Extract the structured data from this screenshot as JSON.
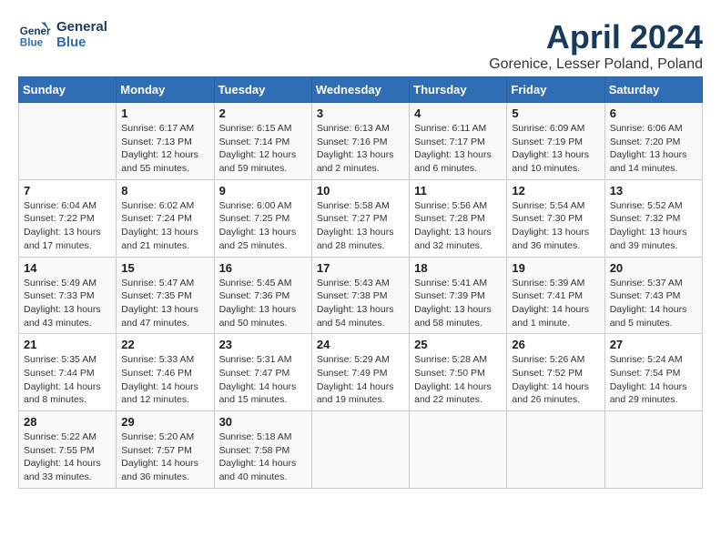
{
  "header": {
    "logo_line1": "General",
    "logo_line2": "Blue",
    "title": "April 2024",
    "location": "Gorenice, Lesser Poland, Poland"
  },
  "days_of_week": [
    "Sunday",
    "Monday",
    "Tuesday",
    "Wednesday",
    "Thursday",
    "Friday",
    "Saturday"
  ],
  "weeks": [
    [
      {
        "day": "",
        "info": ""
      },
      {
        "day": "1",
        "info": "Sunrise: 6:17 AM\nSunset: 7:13 PM\nDaylight: 12 hours\nand 55 minutes."
      },
      {
        "day": "2",
        "info": "Sunrise: 6:15 AM\nSunset: 7:14 PM\nDaylight: 12 hours\nand 59 minutes."
      },
      {
        "day": "3",
        "info": "Sunrise: 6:13 AM\nSunset: 7:16 PM\nDaylight: 13 hours\nand 2 minutes."
      },
      {
        "day": "4",
        "info": "Sunrise: 6:11 AM\nSunset: 7:17 PM\nDaylight: 13 hours\nand 6 minutes."
      },
      {
        "day": "5",
        "info": "Sunrise: 6:09 AM\nSunset: 7:19 PM\nDaylight: 13 hours\nand 10 minutes."
      },
      {
        "day": "6",
        "info": "Sunrise: 6:06 AM\nSunset: 7:20 PM\nDaylight: 13 hours\nand 14 minutes."
      }
    ],
    [
      {
        "day": "7",
        "info": "Sunrise: 6:04 AM\nSunset: 7:22 PM\nDaylight: 13 hours\nand 17 minutes."
      },
      {
        "day": "8",
        "info": "Sunrise: 6:02 AM\nSunset: 7:24 PM\nDaylight: 13 hours\nand 21 minutes."
      },
      {
        "day": "9",
        "info": "Sunrise: 6:00 AM\nSunset: 7:25 PM\nDaylight: 13 hours\nand 25 minutes."
      },
      {
        "day": "10",
        "info": "Sunrise: 5:58 AM\nSunset: 7:27 PM\nDaylight: 13 hours\nand 28 minutes."
      },
      {
        "day": "11",
        "info": "Sunrise: 5:56 AM\nSunset: 7:28 PM\nDaylight: 13 hours\nand 32 minutes."
      },
      {
        "day": "12",
        "info": "Sunrise: 5:54 AM\nSunset: 7:30 PM\nDaylight: 13 hours\nand 36 minutes."
      },
      {
        "day": "13",
        "info": "Sunrise: 5:52 AM\nSunset: 7:32 PM\nDaylight: 13 hours\nand 39 minutes."
      }
    ],
    [
      {
        "day": "14",
        "info": "Sunrise: 5:49 AM\nSunset: 7:33 PM\nDaylight: 13 hours\nand 43 minutes."
      },
      {
        "day": "15",
        "info": "Sunrise: 5:47 AM\nSunset: 7:35 PM\nDaylight: 13 hours\nand 47 minutes."
      },
      {
        "day": "16",
        "info": "Sunrise: 5:45 AM\nSunset: 7:36 PM\nDaylight: 13 hours\nand 50 minutes."
      },
      {
        "day": "17",
        "info": "Sunrise: 5:43 AM\nSunset: 7:38 PM\nDaylight: 13 hours\nand 54 minutes."
      },
      {
        "day": "18",
        "info": "Sunrise: 5:41 AM\nSunset: 7:39 PM\nDaylight: 13 hours\nand 58 minutes."
      },
      {
        "day": "19",
        "info": "Sunrise: 5:39 AM\nSunset: 7:41 PM\nDaylight: 14 hours\nand 1 minute."
      },
      {
        "day": "20",
        "info": "Sunrise: 5:37 AM\nSunset: 7:43 PM\nDaylight: 14 hours\nand 5 minutes."
      }
    ],
    [
      {
        "day": "21",
        "info": "Sunrise: 5:35 AM\nSunset: 7:44 PM\nDaylight: 14 hours\nand 8 minutes."
      },
      {
        "day": "22",
        "info": "Sunrise: 5:33 AM\nSunset: 7:46 PM\nDaylight: 14 hours\nand 12 minutes."
      },
      {
        "day": "23",
        "info": "Sunrise: 5:31 AM\nSunset: 7:47 PM\nDaylight: 14 hours\nand 15 minutes."
      },
      {
        "day": "24",
        "info": "Sunrise: 5:29 AM\nSunset: 7:49 PM\nDaylight: 14 hours\nand 19 minutes."
      },
      {
        "day": "25",
        "info": "Sunrise: 5:28 AM\nSunset: 7:50 PM\nDaylight: 14 hours\nand 22 minutes."
      },
      {
        "day": "26",
        "info": "Sunrise: 5:26 AM\nSunset: 7:52 PM\nDaylight: 14 hours\nand 26 minutes."
      },
      {
        "day": "27",
        "info": "Sunrise: 5:24 AM\nSunset: 7:54 PM\nDaylight: 14 hours\nand 29 minutes."
      }
    ],
    [
      {
        "day": "28",
        "info": "Sunrise: 5:22 AM\nSunset: 7:55 PM\nDaylight: 14 hours\nand 33 minutes."
      },
      {
        "day": "29",
        "info": "Sunrise: 5:20 AM\nSunset: 7:57 PM\nDaylight: 14 hours\nand 36 minutes."
      },
      {
        "day": "30",
        "info": "Sunrise: 5:18 AM\nSunset: 7:58 PM\nDaylight: 14 hours\nand 40 minutes."
      },
      {
        "day": "",
        "info": ""
      },
      {
        "day": "",
        "info": ""
      },
      {
        "day": "",
        "info": ""
      },
      {
        "day": "",
        "info": ""
      }
    ]
  ]
}
